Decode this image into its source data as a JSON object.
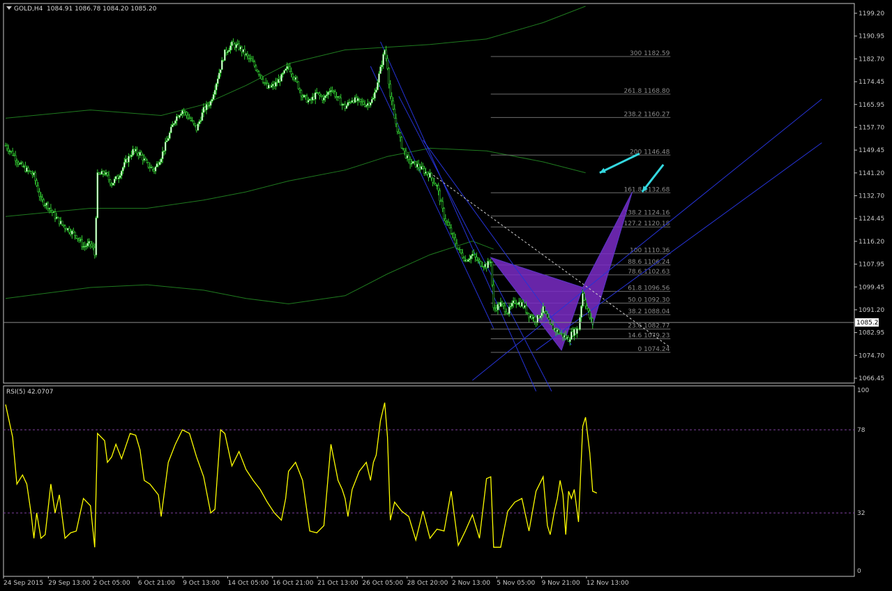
{
  "colors": {
    "background": "#000000",
    "frame": "#c8c8c8",
    "candle": "#32cd32",
    "envelope": "#1f7a1f",
    "channel": "#2633d6",
    "fib": "#8a8a8a",
    "pattern": "#7a2cc6",
    "arrow": "#34d8e0",
    "rsi": "#ffff00",
    "rsi_levels": "#8040a0"
  },
  "chart_data": [
    {
      "type": "candlestick",
      "title": "GOLD,H4",
      "ohlc_readout": [
        "1084.91",
        "1086.78",
        "1084.20",
        "1085.20"
      ],
      "ylim": [
        1063,
        1202
      ],
      "y_ticks": [
        "1199.20",
        "1190.95",
        "1182.70",
        "1174.45",
        "1165.95",
        "1157.70",
        "1149.45",
        "1141.20",
        "1132.70",
        "1124.45",
        "1116.20",
        "1107.95",
        "1099.45",
        "1091.20",
        "1082.95",
        "1074.70",
        "1066.45"
      ],
      "current_price": "1085.20",
      "x_ticks": [
        "24 Sep 2015",
        "29 Sep 13:00",
        "2 Oct 05:00",
        "6 Oct 21:00",
        "9 Oct 13:00",
        "14 Oct 05:00",
        "16 Oct 21:00",
        "21 Oct 13:00",
        "26 Oct 05:00",
        "28 Oct 20:00",
        "2 Nov 13:00",
        "5 Nov 05:00",
        "9 Nov 21:00",
        "12 Nov 13:00"
      ],
      "close_path": [
        [
          0,
          1150
        ],
        [
          5,
          1147
        ],
        [
          10,
          1143
        ],
        [
          15,
          1141
        ],
        [
          20,
          1139
        ],
        [
          25,
          1130
        ],
        [
          30,
          1128
        ],
        [
          35,
          1124
        ],
        [
          40,
          1121
        ],
        [
          45,
          1119
        ],
        [
          50,
          1117
        ],
        [
          55,
          1113
        ],
        [
          60,
          1114
        ],
        [
          62,
          1112
        ],
        [
          63,
          1110
        ],
        [
          65,
          1139
        ],
        [
          70,
          1140
        ],
        [
          75,
          1136
        ],
        [
          80,
          1139
        ],
        [
          85,
          1144
        ],
        [
          90,
          1148
        ],
        [
          95,
          1147
        ],
        [
          100,
          1143
        ],
        [
          105,
          1141
        ],
        [
          110,
          1146
        ],
        [
          115,
          1153
        ],
        [
          120,
          1160
        ],
        [
          125,
          1163
        ],
        [
          130,
          1160
        ],
        [
          135,
          1156
        ],
        [
          140,
          1163
        ],
        [
          145,
          1166
        ],
        [
          150,
          1175
        ],
        [
          155,
          1184
        ],
        [
          160,
          1187
        ],
        [
          165,
          1186
        ],
        [
          170,
          1183
        ],
        [
          175,
          1180
        ],
        [
          180,
          1176
        ],
        [
          185,
          1171
        ],
        [
          190,
          1172
        ],
        [
          195,
          1175
        ],
        [
          200,
          1179
        ],
        [
          205,
          1174
        ],
        [
          210,
          1168
        ],
        [
          215,
          1166
        ],
        [
          220,
          1169
        ],
        [
          225,
          1167
        ],
        [
          230,
          1171
        ],
        [
          235,
          1167
        ],
        [
          240,
          1164
        ],
        [
          245,
          1167
        ],
        [
          250,
          1166
        ],
        [
          255,
          1165
        ],
        [
          260,
          1167
        ],
        [
          265,
          1178
        ],
        [
          268,
          1185
        ],
        [
          270,
          1179
        ],
        [
          272,
          1168
        ],
        [
          275,
          1160
        ],
        [
          280,
          1150
        ],
        [
          285,
          1144
        ],
        [
          290,
          1143
        ],
        [
          295,
          1141
        ],
        [
          300,
          1139
        ],
        [
          305,
          1135
        ],
        [
          310,
          1124
        ],
        [
          315,
          1118
        ],
        [
          320,
          1112
        ],
        [
          325,
          1108
        ],
        [
          330,
          1110
        ],
        [
          335,
          1107
        ],
        [
          340,
          1106
        ],
        [
          343,
          1108
        ],
        [
          345,
          1090
        ],
        [
          350,
          1092
        ],
        [
          355,
          1089
        ],
        [
          360,
          1093
        ],
        [
          365,
          1092
        ],
        [
          370,
          1088
        ],
        [
          375,
          1086
        ],
        [
          380,
          1090
        ],
        [
          385,
          1084
        ],
        [
          390,
          1082
        ],
        [
          395,
          1080
        ],
        [
          398,
          1079
        ],
        [
          400,
          1081
        ],
        [
          405,
          1083
        ],
        [
          408,
          1096
        ],
        [
          410,
          1092
        ],
        [
          413,
          1087
        ],
        [
          415,
          1085
        ]
      ],
      "envelope_upper": [
        [
          0,
          1160
        ],
        [
          60,
          1163
        ],
        [
          110,
          1161
        ],
        [
          140,
          1165
        ],
        [
          170,
          1172
        ],
        [
          200,
          1180
        ],
        [
          240,
          1185
        ],
        [
          270,
          1186
        ],
        [
          300,
          1187
        ],
        [
          340,
          1189
        ],
        [
          380,
          1195
        ],
        [
          410,
          1201
        ]
      ],
      "envelope_mid": [
        [
          0,
          1124
        ],
        [
          60,
          1127
        ],
        [
          100,
          1127
        ],
        [
          140,
          1130
        ],
        [
          170,
          1133
        ],
        [
          200,
          1137
        ],
        [
          240,
          1141
        ],
        [
          270,
          1146
        ],
        [
          300,
          1149
        ],
        [
          340,
          1148
        ],
        [
          380,
          1144
        ],
        [
          410,
          1140
        ]
      ],
      "envelope_lower": [
        [
          0,
          1094
        ],
        [
          60,
          1098
        ],
        [
          100,
          1099
        ],
        [
          140,
          1097
        ],
        [
          170,
          1094
        ],
        [
          200,
          1092
        ],
        [
          240,
          1095
        ],
        [
          270,
          1103
        ],
        [
          300,
          1110
        ],
        [
          330,
          1115
        ],
        [
          345,
          1112
        ]
      ],
      "fibonacci": [
        {
          "label": "300 1182.59",
          "price": 1182.59
        },
        {
          "label": "261.8 1168.80",
          "price": 1168.8
        },
        {
          "label": "238.2 1160.27",
          "price": 1160.27
        },
        {
          "label": "200 1146.48",
          "price": 1146.48
        },
        {
          "label": "161.8 1132.68",
          "price": 1132.68
        },
        {
          "label": "138.2 1124.16",
          "price": 1124.16
        },
        {
          "label": "127.2 1120.18",
          "price": 1120.18
        },
        {
          "label": "100 1110.36",
          "price": 1110.36
        },
        {
          "label": "88.6 1106.24",
          "price": 1106.24
        },
        {
          "label": "78.6 1102.63",
          "price": 1102.63
        },
        {
          "label": "61.8 1096.56",
          "price": 1096.56
        },
        {
          "label": "50.0 1092.30",
          "price": 1092.3
        },
        {
          "label": "38.2 1088.04",
          "price": 1088.04
        },
        {
          "label": "23.6 1082.77",
          "price": 1082.77
        },
        {
          "label": "14.6 1079.23",
          "price": 1079.23
        },
        {
          "label": "0 1074.24",
          "price": 1074.24
        }
      ],
      "channel_lines": [
        [
          [
            265,
            1188
          ],
          [
            375,
            1060
          ]
        ],
        [
          [
            278,
            1168
          ],
          [
            386,
            1060
          ]
        ],
        [
          [
            295,
            1152
          ],
          [
            400,
            1077
          ]
        ],
        [
          [
            258,
            1179
          ],
          [
            345,
            1083
          ]
        ],
        [
          [
            330,
            1064
          ],
          [
            577,
            1167
          ]
        ],
        [
          [
            375,
            1075
          ],
          [
            577,
            1151
          ]
        ]
      ],
      "trendline_dashed": [
        [
          300,
          1140
        ],
        [
          470,
          1076
        ]
      ],
      "pattern_xabcd": [
        [
          343,
          1109
        ],
        [
          393,
          1075
        ],
        [
          408,
          1098
        ],
        [
          415,
          1084
        ],
        [
          443,
          1133
        ]
      ],
      "arrows": [
        [
          [
            448,
            1147
          ],
          [
            420,
            1140
          ]
        ],
        [
          [
            465,
            1143
          ],
          [
            450,
            1133
          ]
        ]
      ]
    },
    {
      "type": "line",
      "title": "RSI(5) 42.0707",
      "ylim": [
        0,
        100
      ],
      "y_ticks": [
        "100",
        "78",
        "32",
        "0"
      ],
      "levels": [
        78,
        32
      ],
      "values": [
        [
          0,
          92
        ],
        [
          5,
          74
        ],
        [
          8,
          48
        ],
        [
          12,
          53
        ],
        [
          15,
          48
        ],
        [
          18,
          32
        ],
        [
          20,
          18
        ],
        [
          22,
          32
        ],
        [
          25,
          18
        ],
        [
          28,
          20
        ],
        [
          32,
          48
        ],
        [
          35,
          32
        ],
        [
          38,
          42
        ],
        [
          42,
          18
        ],
        [
          46,
          21
        ],
        [
          50,
          22
        ],
        [
          55,
          40
        ],
        [
          60,
          36
        ],
        [
          63,
          13
        ],
        [
          65,
          76
        ],
        [
          70,
          72
        ],
        [
          72,
          60
        ],
        [
          75,
          63
        ],
        [
          78,
          70
        ],
        [
          82,
          62
        ],
        [
          88,
          76
        ],
        [
          92,
          75
        ],
        [
          95,
          67
        ],
        [
          98,
          50
        ],
        [
          102,
          48
        ],
        [
          108,
          42
        ],
        [
          110,
          30
        ],
        [
          115,
          60
        ],
        [
          120,
          70
        ],
        [
          125,
          78
        ],
        [
          130,
          76
        ],
        [
          135,
          63
        ],
        [
          140,
          52
        ],
        [
          145,
          32
        ],
        [
          148,
          34
        ],
        [
          152,
          78
        ],
        [
          155,
          76
        ],
        [
          160,
          58
        ],
        [
          165,
          66
        ],
        [
          170,
          56
        ],
        [
          175,
          50
        ],
        [
          180,
          45
        ],
        [
          185,
          38
        ],
        [
          190,
          32
        ],
        [
          195,
          28
        ],
        [
          198,
          40
        ],
        [
          200,
          55
        ],
        [
          205,
          60
        ],
        [
          210,
          50
        ],
        [
          215,
          22
        ],
        [
          220,
          21
        ],
        [
          225,
          25
        ],
        [
          230,
          70
        ],
        [
          235,
          50
        ],
        [
          238,
          45
        ],
        [
          240,
          40
        ],
        [
          242,
          30
        ],
        [
          245,
          45
        ],
        [
          250,
          55
        ],
        [
          255,
          60
        ],
        [
          258,
          50
        ],
        [
          260,
          60
        ],
        [
          262,
          64
        ],
        [
          265,
          83
        ],
        [
          268,
          93
        ],
        [
          270,
          74
        ],
        [
          272,
          28
        ],
        [
          275,
          38
        ],
        [
          280,
          33
        ],
        [
          285,
          30
        ],
        [
          290,
          17
        ],
        [
          295,
          33
        ],
        [
          300,
          18
        ],
        [
          305,
          23
        ],
        [
          310,
          22
        ],
        [
          315,
          44
        ],
        [
          320,
          14
        ],
        [
          325,
          22
        ],
        [
          330,
          31
        ],
        [
          335,
          18
        ],
        [
          340,
          51
        ],
        [
          343,
          52
        ],
        [
          345,
          13
        ],
        [
          350,
          13
        ],
        [
          355,
          33
        ],
        [
          360,
          38
        ],
        [
          365,
          40
        ],
        [
          370,
          22
        ],
        [
          375,
          44
        ],
        [
          380,
          52
        ],
        [
          383,
          25
        ],
        [
          385,
          20
        ],
        [
          388,
          33
        ],
        [
          390,
          40
        ],
        [
          392,
          50
        ],
        [
          394,
          42
        ],
        [
          396,
          20
        ],
        [
          398,
          44
        ],
        [
          400,
          40
        ],
        [
          402,
          45
        ],
        [
          405,
          27
        ],
        [
          408,
          80
        ],
        [
          410,
          85
        ],
        [
          413,
          65
        ],
        [
          415,
          44
        ],
        [
          418,
          43
        ]
      ]
    }
  ]
}
